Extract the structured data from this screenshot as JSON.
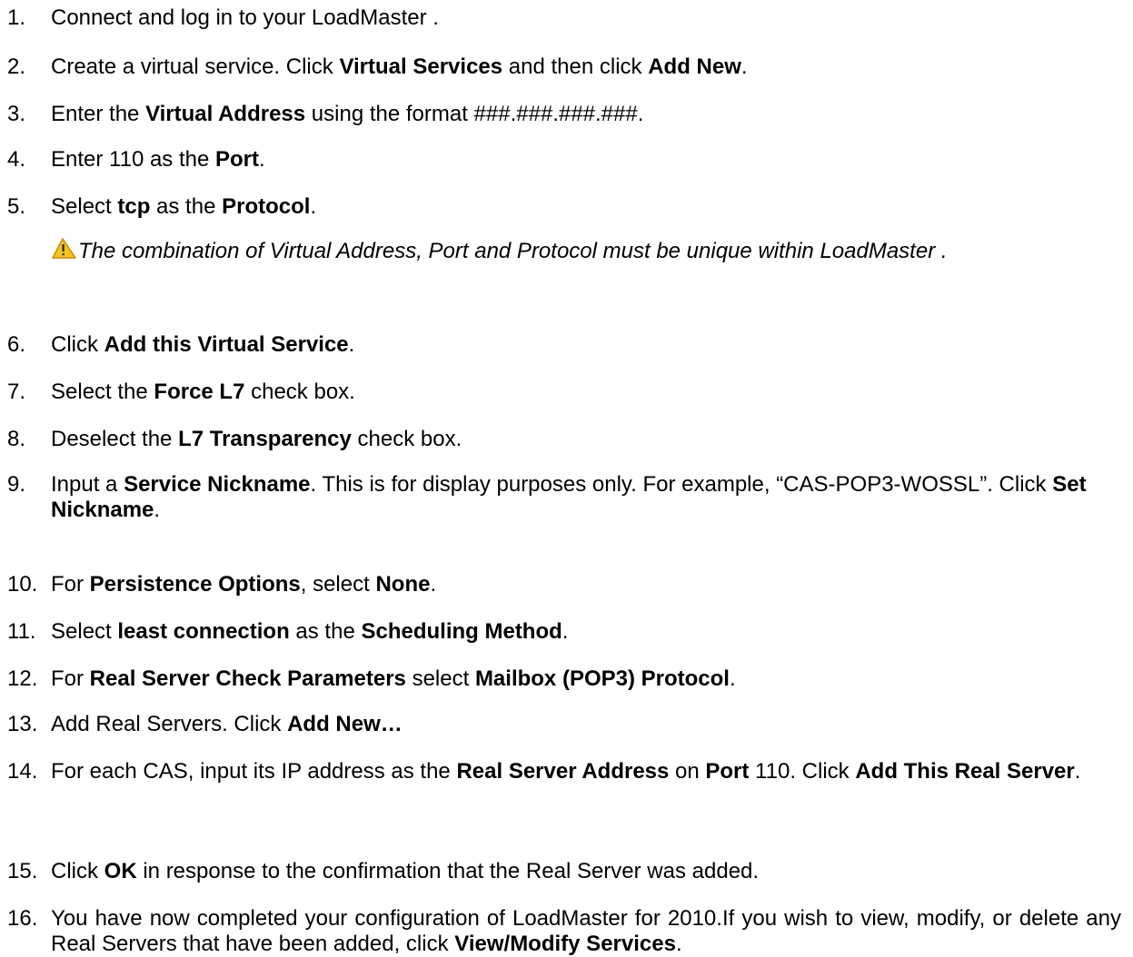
{
  "steps": [
    {
      "num": "1.",
      "parts": [
        {
          "t": "Connect and log in to your LoadMaster  ."
        }
      ]
    },
    {
      "num": "2.",
      "parts": [
        {
          "t": "Create a virtual service. Click "
        },
        {
          "t": "Virtual Services",
          "b": true
        },
        {
          "t": " and then click "
        },
        {
          "t": "Add New",
          "b": true
        },
        {
          "t": "."
        }
      ]
    },
    {
      "num": "3.",
      "parts": [
        {
          "t": "Enter the "
        },
        {
          "t": "Virtual Address",
          "b": true
        },
        {
          "t": " using the format ###.###.###.###."
        }
      ]
    },
    {
      "num": "4.",
      "parts": [
        {
          "t": "Enter 110 as the "
        },
        {
          "t": "Port",
          "b": true
        },
        {
          "t": "."
        }
      ]
    },
    {
      "num": "5.",
      "parts": [
        {
          "t": "Select "
        },
        {
          "t": "tcp",
          "b": true
        },
        {
          "t": " as the "
        },
        {
          "t": "Protocol",
          "b": true
        },
        {
          "t": "."
        }
      ],
      "note": "The combination of Virtual Address, Port and Protocol must be unique within LoadMaster  ."
    },
    {
      "num": "6.",
      "parts": [
        {
          "t": "Click "
        },
        {
          "t": "Add this Virtual Service",
          "b": true
        },
        {
          "t": "."
        }
      ]
    },
    {
      "num": "7.",
      "parts": [
        {
          "t": "Select the "
        },
        {
          "t": "Force L7",
          "b": true
        },
        {
          "t": " check box."
        }
      ]
    },
    {
      "num": "8.",
      "parts": [
        {
          "t": "Deselect the "
        },
        {
          "t": "L7 Transparency",
          "b": true
        },
        {
          "t": " check box."
        }
      ]
    },
    {
      "num": "9.",
      "parts": [
        {
          "t": "Input a "
        },
        {
          "t": "Service Nickname",
          "b": true
        },
        {
          "t": ". This is for display purposes only. For example, “CAS-POP3-WOSSL”. Click "
        },
        {
          "t": "Set Nickname",
          "b": true
        },
        {
          "t": "."
        }
      ]
    },
    {
      "num": "10.",
      "parts": [
        {
          "t": "For "
        },
        {
          "t": "Persistence Options",
          "b": true
        },
        {
          "t": ", select "
        },
        {
          "t": "None",
          "b": true
        },
        {
          "t": "."
        }
      ]
    },
    {
      "num": "11.",
      "parts": [
        {
          "t": "Select "
        },
        {
          "t": "least connection",
          "b": true
        },
        {
          "t": " as the "
        },
        {
          "t": "Scheduling Method",
          "b": true
        },
        {
          "t": "."
        }
      ]
    },
    {
      "num": "12.",
      "parts": [
        {
          "t": "For "
        },
        {
          "t": "Real Server Check Parameters",
          "b": true
        },
        {
          "t": " select "
        },
        {
          "t": "Mailbox (POP3) Protocol",
          "b": true
        },
        {
          "t": "."
        }
      ]
    },
    {
      "num": "13.",
      "parts": [
        {
          "t": "Add Real Servers. Click "
        },
        {
          "t": "Add New…",
          "b": true
        }
      ]
    },
    {
      "num": "14.",
      "parts": [
        {
          "t": "For each CAS, input its IP address as the "
        },
        {
          "t": "Real Server Address",
          "b": true
        },
        {
          "t": " on "
        },
        {
          "t": "Port",
          "b": true
        },
        {
          "t": " 110. Click "
        },
        {
          "t": "Add This Real Server",
          "b": true
        },
        {
          "t": "."
        }
      ]
    },
    {
      "num": "15.",
      "parts": [
        {
          "t": "Click "
        },
        {
          "t": "OK",
          "b": true
        },
        {
          "t": " in response to the confirmation that the Real Server was added."
        }
      ]
    },
    {
      "num": "16.",
      "parts": [
        {
          "t": "You have now completed your configuration of LoadMaster for  2010.If you wish to view, modify, or delete any Real Servers that have been added, click "
        },
        {
          "t": "View/Modify Services",
          "b": true
        },
        {
          "t": "."
        }
      ]
    }
  ],
  "colors": {
    "text": "#000000",
    "warning_fill": "#f5c518",
    "warning_stroke": "#c98a00"
  },
  "icons": {
    "warning": "warning-icon"
  }
}
